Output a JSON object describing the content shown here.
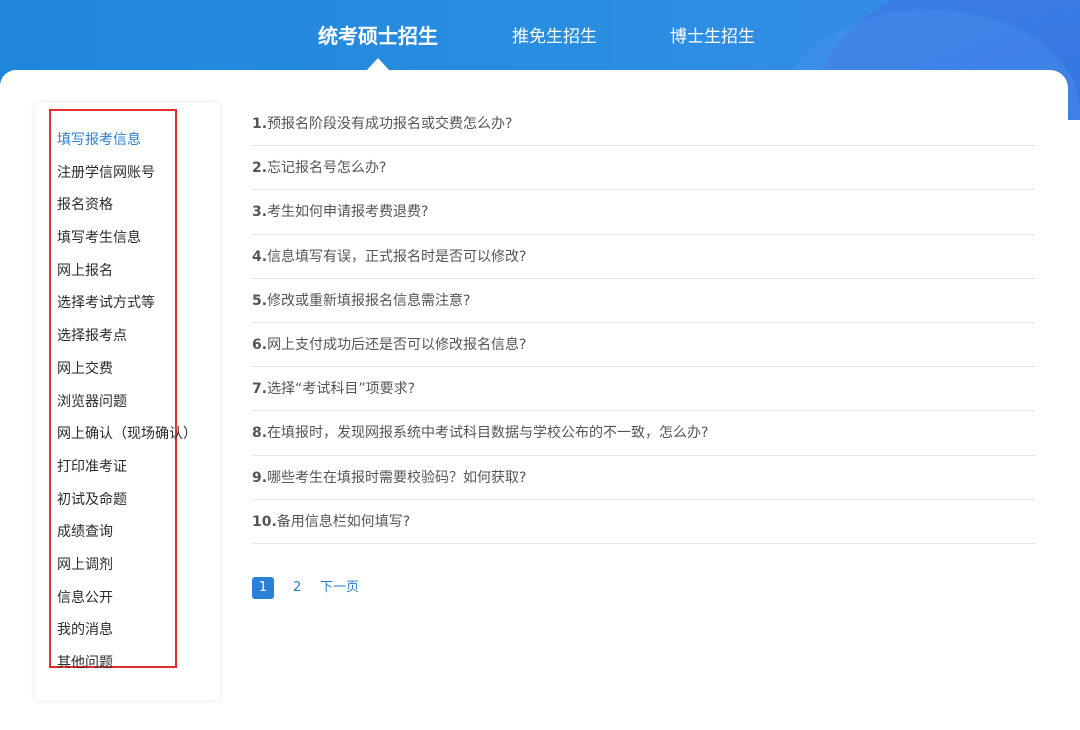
{
  "header": {
    "tabs": [
      {
        "label": "统考硕士招生",
        "active": true
      },
      {
        "label": "推免生招生",
        "active": false
      },
      {
        "label": "博士生招生",
        "active": false
      }
    ]
  },
  "sidebar": {
    "items": [
      {
        "label": "填写报考信息",
        "active": true
      },
      {
        "label": "注册学信网账号"
      },
      {
        "label": "报名资格"
      },
      {
        "label": "填写考生信息"
      },
      {
        "label": "网上报名"
      },
      {
        "label": "选择考试方式等"
      },
      {
        "label": "选择报考点"
      },
      {
        "label": "网上交费"
      },
      {
        "label": "浏览器问题"
      },
      {
        "label": "网上确认（现场确认）"
      },
      {
        "label": "打印准考证"
      },
      {
        "label": "初试及命题"
      },
      {
        "label": "成绩查询"
      },
      {
        "label": "网上调剂"
      },
      {
        "label": "信息公开"
      },
      {
        "label": "我的消息"
      },
      {
        "label": "其他问题"
      }
    ]
  },
  "faq": {
    "items": [
      {
        "num": "1.",
        "text": "预报名阶段没有成功报名或交费怎么办?"
      },
      {
        "num": "2.",
        "text": "忘记报名号怎么办?"
      },
      {
        "num": "3.",
        "text": "考生如何申请报考费退费?"
      },
      {
        "num": "4.",
        "text": "信息填写有误，正式报名时是否可以修改?"
      },
      {
        "num": "5.",
        "text": "修改或重新填报报名信息需注意?"
      },
      {
        "num": "6.",
        "text": "网上支付成功后还是否可以修改报名信息?"
      },
      {
        "num": "7.",
        "text": "选择“考试科目”项要求?"
      },
      {
        "num": "8.",
        "text": "在填报时，发现网报系统中考试科目数据与学校公布的不一致，怎么办?"
      },
      {
        "num": "9.",
        "text": "哪些考生在填报时需要校验码？如何获取?"
      },
      {
        "num": "10.",
        "text": "备用信息栏如何填写?"
      }
    ]
  },
  "pagination": {
    "current": "1",
    "page2": "2",
    "next_label": "下一页"
  },
  "colors": {
    "header_blue": "#1f86dc",
    "accent_link": "#2b7fd4",
    "highlight_box": "#e0302e"
  }
}
